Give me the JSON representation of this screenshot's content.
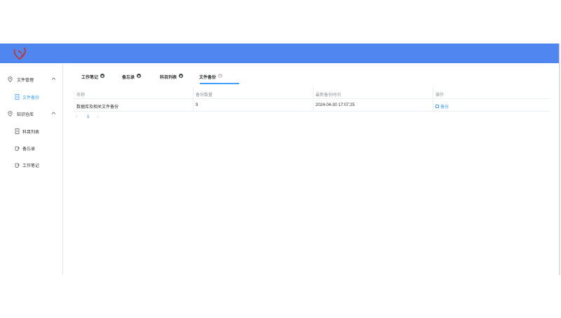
{
  "sidebar": {
    "groups": [
      {
        "label": "文件管理",
        "items": [
          {
            "label": "文件备份",
            "active": true
          }
        ]
      },
      {
        "label": "知识仓库",
        "items": [
          {
            "label": "科目列表"
          },
          {
            "label": "备忘录"
          },
          {
            "label": "工作笔记"
          }
        ]
      }
    ]
  },
  "tabs": [
    {
      "label": "工作笔记"
    },
    {
      "label": "备忘录"
    },
    {
      "label": "科目列表"
    },
    {
      "label": "文件备份",
      "active": true
    }
  ],
  "table": {
    "headers": [
      "名称",
      "备份数量",
      "最新备份时间",
      "操作"
    ],
    "rows": [
      {
        "name": "数据库及相关文件备份",
        "count": "9",
        "time": "2024-04-30 17:07:25",
        "action": "备份"
      }
    ]
  },
  "pagination": {
    "prev": "‹",
    "page": "1",
    "next": "›"
  },
  "colors": {
    "header": "#4f86f0",
    "accent": "#409eff",
    "logo": "#c0392b"
  }
}
